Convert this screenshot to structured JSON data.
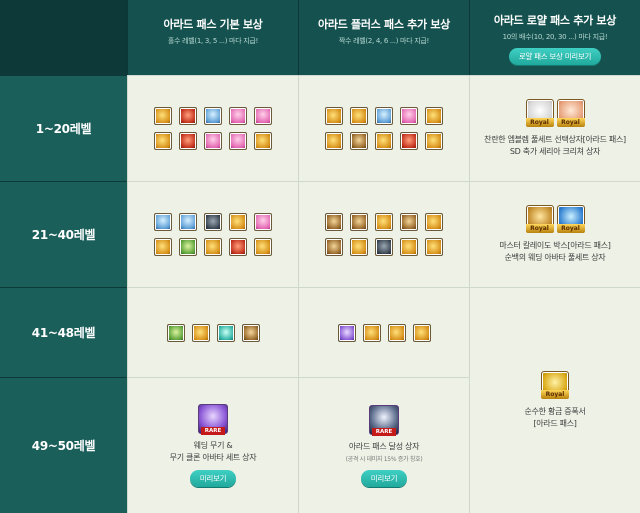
{
  "headers": {
    "basic": {
      "title": "아라드 패스 기본 보상",
      "sub": "홀수 레벨(1, 3, 5 ...) 마다 지급!"
    },
    "plus": {
      "title": "아라드 플러스 패스 추가 보상",
      "sub": "짝수 레벨(2, 4, 6 ...) 마다 지급!"
    },
    "royal": {
      "title": "아라드 로얄 패스 추가 보상",
      "sub": "10의 배수(10, 20, 30 ...) 마다 지급!",
      "button": "로얄 패스 보상 미리보기"
    }
  },
  "levels": [
    "1~20레벨",
    "21~40레벨",
    "41~48레벨",
    "49~50레벨"
  ],
  "royal_rewards": {
    "r1": {
      "tag1": "Royal",
      "tag2": "Royal",
      "line1": "찬란한 엠블렘 풀세트 선택상자[아라드 패스]",
      "line2": "SD 축가 세리아 크리쳐 상자"
    },
    "r2": {
      "tag1": "Royal",
      "tag2": "Royal",
      "line1": "마스터 칼레이도 박스[아라드 패스]",
      "line2": "순백의 웨딩 아바타 풀세트 상자"
    },
    "r3": {
      "tag": "Royal",
      "line1": "순수한 황금 증폭서",
      "line2": "[아라드 패스]"
    }
  },
  "final": {
    "basic": {
      "tag": "RARE",
      "line1": "웨딩 무기 &",
      "line2": "무기 클론 아바타 세트 상자",
      "button": "미리보기"
    },
    "plus": {
      "tag": "RARE",
      "line1": "아라드 패스 달성 상자",
      "note": "(공격 시 데미지 15% 증가 칭호)",
      "button": "미리보기"
    }
  },
  "icons": {
    "row1_basic": [
      "gold",
      "red",
      "blue",
      "pink",
      "pink",
      "gold",
      "red",
      "pink",
      "pink",
      "gold"
    ],
    "row1_plus": [
      "gold",
      "gold",
      "blue",
      "pink",
      "gold",
      "gold",
      "brown",
      "gold",
      "red",
      "gold"
    ],
    "row2_basic": [
      "blue",
      "blue",
      "dark",
      "gold",
      "pink",
      "gold",
      "green",
      "gold",
      "red",
      "gold"
    ],
    "row2_plus": [
      "brown",
      "brown",
      "gold",
      "brown",
      "gold",
      "brown",
      "gold",
      "dark",
      "gold",
      "gold"
    ],
    "row3_basic": [
      "green",
      "gold",
      "teal",
      "brown"
    ],
    "row3_plus": [
      "purple",
      "gold",
      "gold",
      "gold"
    ]
  }
}
